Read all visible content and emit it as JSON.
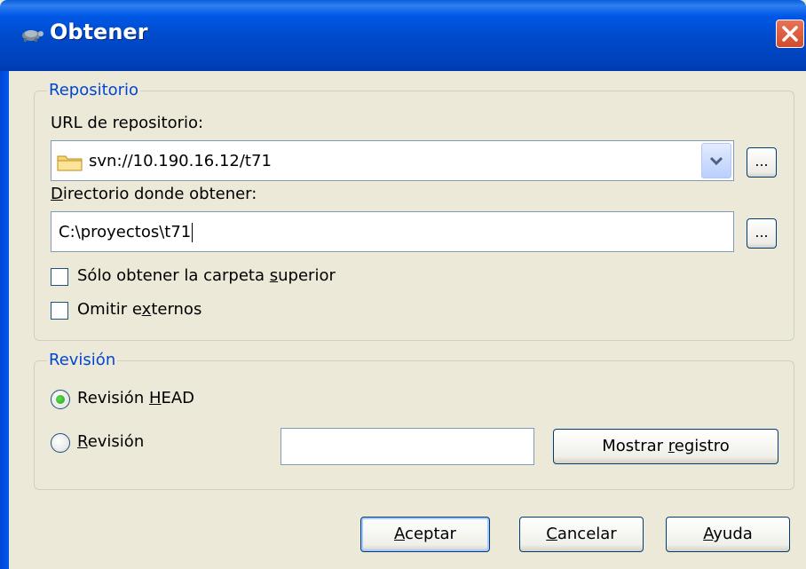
{
  "window": {
    "title": "Obtener"
  },
  "repositorio": {
    "legend": "Repositorio",
    "url_label": "URL de repositorio:",
    "url_value": "svn://10.190.16.12/t71",
    "url_browse": "...",
    "dir_label": "Directorio donde obtener:",
    "dir_value": "C:\\proyectos\\t71",
    "dir_browse": "...",
    "only_top_folder": "Sólo obtener la carpeta superior",
    "omit_externals": "Omitir externos"
  },
  "revision": {
    "legend": "Revisión",
    "head_label": "Revisión HEAD",
    "head_selected": true,
    "rev_label": "Revisión",
    "rev_value": "",
    "show_log": "Mostrar registro"
  },
  "buttons": {
    "ok": "Aceptar",
    "cancel": "Cancelar",
    "help": "Ayuda"
  },
  "colors": {
    "title_bar": "#0058E6",
    "group_legend": "#0046D5",
    "dialog_bg": "#ECE9D8",
    "close_button": "#D34B2E"
  }
}
